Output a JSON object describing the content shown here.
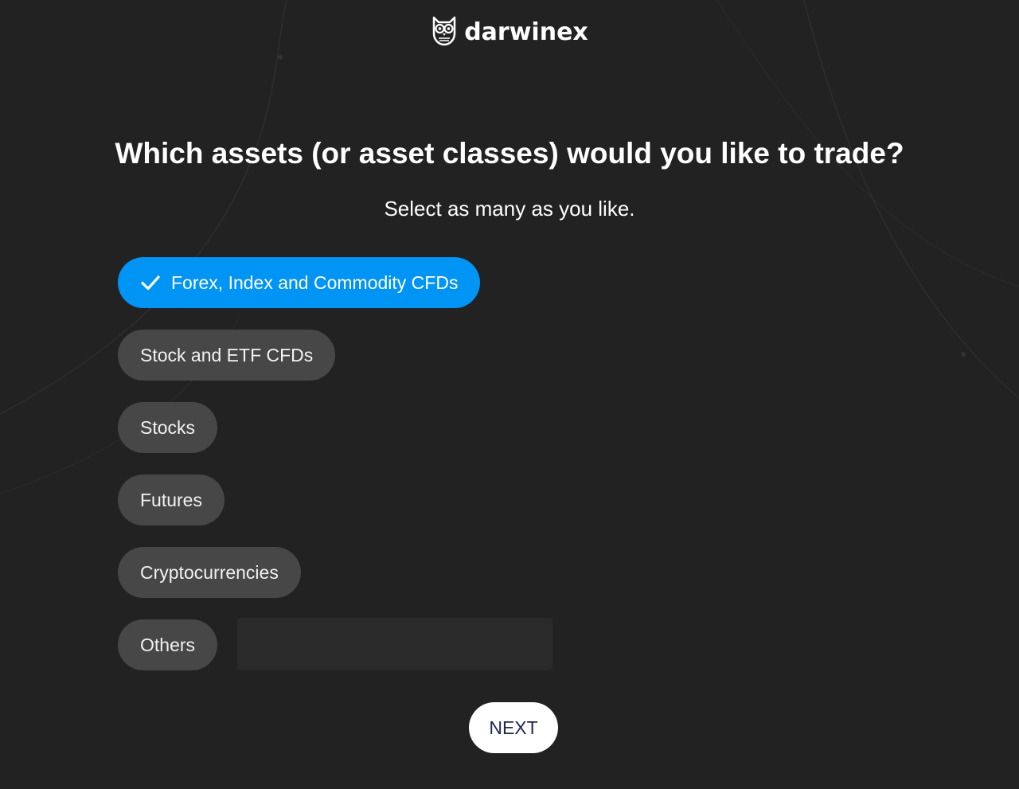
{
  "brand": {
    "name": "darwinex",
    "logo_icon": "owl-icon"
  },
  "question": {
    "title": "Which assets (or asset classes) would you like to trade?",
    "subtitle": "Select as many as you like."
  },
  "options": [
    {
      "label": "Forex, Index and Commodity CFDs",
      "selected": true
    },
    {
      "label": "Stock and ETF CFDs",
      "selected": false
    },
    {
      "label": "Stocks",
      "selected": false
    },
    {
      "label": "Futures",
      "selected": false
    },
    {
      "label": "Cryptocurrencies",
      "selected": false
    },
    {
      "label": "Others",
      "selected": false
    }
  ],
  "others_input": {
    "value": "",
    "placeholder": ""
  },
  "next_label": "NEXT",
  "colors": {
    "background": "#222223",
    "selected_option": "#0094f5",
    "unselected_option": "#474747",
    "next_button": "#ffffff",
    "next_text": "#1c2b4a"
  }
}
